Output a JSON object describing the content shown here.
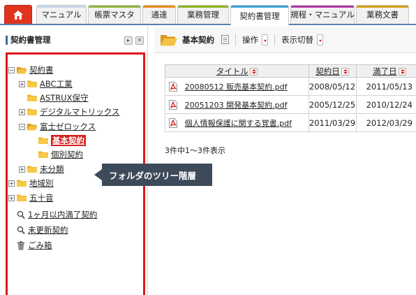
{
  "tabs": [
    {
      "label": "",
      "icon": "home-icon",
      "color": "#e0341f"
    },
    {
      "label": "マニュアル",
      "color": "#c9d7e8"
    },
    {
      "label": "帳票マスタ",
      "color": "#8fb53a"
    },
    {
      "label": "通達",
      "color": "#e58b1d"
    },
    {
      "label": "業務管理",
      "color": "#8ab520"
    },
    {
      "label": "契約書管理",
      "color": "#3aa0d8"
    },
    {
      "label": "規程・マニュアル",
      "color": "#b13aa3"
    },
    {
      "label": "業務文書",
      "color": "#d3a017"
    }
  ],
  "left_panel": {
    "title": "契約書管理",
    "tree": [
      {
        "label": "契約書",
        "expander": "−",
        "icon": "folder-open-icon"
      },
      {
        "label": "ABC工業",
        "expander": "+",
        "icon": "folder-icon"
      },
      {
        "label": "ASTRUX保守",
        "expander": "",
        "icon": "folder-icon"
      },
      {
        "label": "デジタルマトリックス",
        "expander": "+",
        "icon": "folder-icon"
      },
      {
        "label": "富士ゼロックス",
        "expander": "−",
        "icon": "folder-open-icon"
      },
      {
        "label": "基本契約",
        "expander": "",
        "icon": "folder-icon",
        "selected": true
      },
      {
        "label": "個別契約",
        "expander": "",
        "icon": "folder-icon"
      },
      {
        "label": "未分類",
        "expander": "+",
        "icon": "folder-icon"
      },
      {
        "label": "地域別",
        "expander": "+",
        "icon": "folder-icon"
      },
      {
        "label": "五十音",
        "expander": "+",
        "icon": "folder-icon"
      }
    ],
    "searches": [
      {
        "label": "1ヶ月以内満了契約",
        "icon": "search-icon"
      },
      {
        "label": "未更新契約",
        "icon": "search-icon"
      },
      {
        "label": "ごみ箱",
        "icon": "trash-icon"
      }
    ]
  },
  "tooltip": "フォルダのツリー階層",
  "right_panel": {
    "title": "基本契約",
    "menu_operation": "操作",
    "menu_view": "表示切替",
    "table": {
      "headers": [
        "タイトル",
        "契約日",
        "満了日"
      ],
      "rows": [
        {
          "title": "20080512 販売基本契約.pdf",
          "start": "2008/05/12",
          "end": "2011/05/13"
        },
        {
          "title": "20051203 開発基本契約.pdf",
          "start": "2005/12/25",
          "end": "2010/12/24"
        },
        {
          "title": "個人情報保護に関する覚書.pdf",
          "start": "2011/03/29",
          "end": "2012/03/29"
        }
      ]
    },
    "count_text": "3件中1～3件表示"
  },
  "colors": {
    "selection": "#d42222",
    "highlight_border": "#e0161b",
    "folder": "#f0b429"
  }
}
